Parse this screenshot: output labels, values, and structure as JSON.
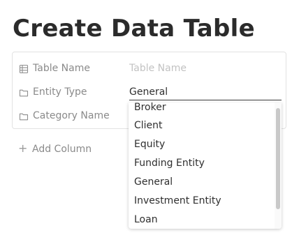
{
  "page": {
    "title": "Create Data Table"
  },
  "form": {
    "rows": [
      {
        "label": "Table Name",
        "icon": "table-icon",
        "placeholder": "Table Name",
        "value": ""
      },
      {
        "label": "Entity Type",
        "icon": "folder-icon",
        "value": "General"
      },
      {
        "label": "Category Name",
        "icon": "folder-icon"
      }
    ]
  },
  "add_column": {
    "label": "Add Column",
    "icon": "plus-icon"
  },
  "dropdown": {
    "options": [
      "Broker",
      "Client",
      "Equity",
      "Funding Entity",
      "General",
      "Investment Entity",
      "Loan"
    ]
  }
}
